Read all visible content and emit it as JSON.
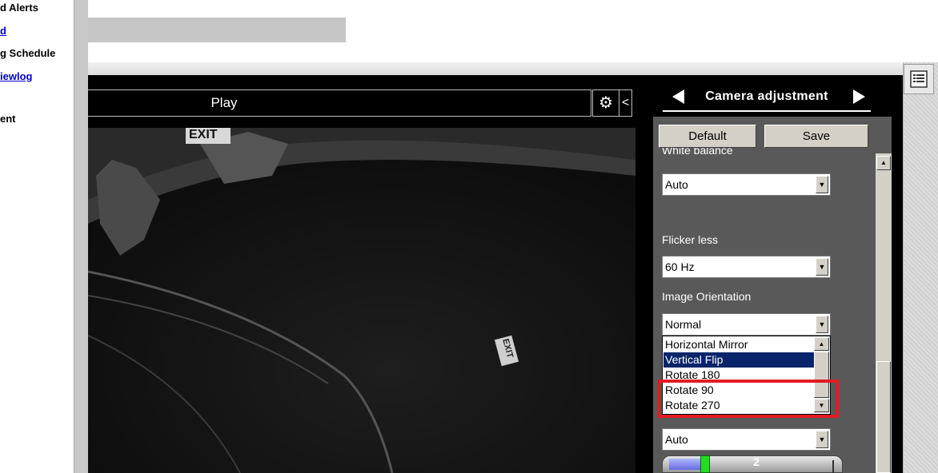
{
  "nav": {
    "items": [
      {
        "label": "d Alerts",
        "link": false
      },
      {
        "label": "d",
        "link": true
      },
      {
        "label": "g Schedule",
        "link": false
      },
      {
        "label": "iewlog",
        "link": true
      },
      {
        "label": "ent",
        "link": false
      }
    ]
  },
  "player": {
    "play_label": "Play",
    "gear_icon": "gear-icon",
    "collapse_glyph": "<"
  },
  "video": {
    "exit_sign_1": "EXIT",
    "exit_sign_2": "EXIT"
  },
  "camera_panel": {
    "title": "Camera adjustment",
    "default_label": "Default",
    "save_label": "Save",
    "white_balance_label": "White balance",
    "white_balance_value": "Auto",
    "flicker_label": "Flicker less",
    "flicker_value": "60 Hz",
    "orientation_label": "Image Orientation",
    "orientation_value": "Normal",
    "orientation_options": [
      "Horizontal Mirror",
      "Vertical Flip",
      "Rotate 180",
      "Rotate 90",
      "Rotate 270"
    ],
    "orientation_highlighted": "Vertical Flip",
    "next_select_value": "Auto",
    "slider_value": "2"
  },
  "colors": {
    "panel_bg": "#595959",
    "highlight": "#0a246a",
    "annotation_red": "#e31b23",
    "link": "#0000cc"
  }
}
